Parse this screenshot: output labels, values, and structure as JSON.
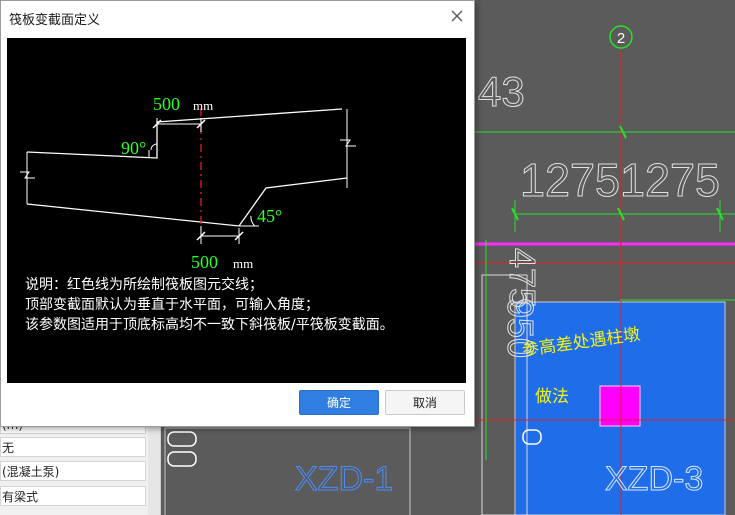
{
  "dialog": {
    "title": "筏板变截面定义",
    "ok_label": "确定",
    "cancel_label": "取消"
  },
  "diagram": {
    "dim_top_value": "500",
    "dim_top_unit": "mm",
    "angle_top": "90°",
    "angle_bottom": "45°",
    "dim_bottom_value": "500",
    "dim_bottom_unit": "mm"
  },
  "description": [
    "说明：红色线为所绘制筏板图元交线；",
    "顶部变截面默认为垂直于水平面，可输入角度；",
    "该参数图适用于顶底标高均不一致下斜筏板/平筏板变截面。"
  ],
  "properties_panel": {
    "rows": [
      "(m)",
      "无",
      "(混凝土泵)",
      "有梁式"
    ]
  },
  "cad": {
    "axis_label": "2",
    "dim_text_top": "43",
    "dim_text_mid": "12751275",
    "dim_text_vertical": "475",
    "dim_text_left_vertical": "950",
    "annotation_line1": "参高差处遇柱墩",
    "annotation_line2": "做法",
    "footing_left": "XZD-1",
    "footing_right": "XZD-3"
  }
}
